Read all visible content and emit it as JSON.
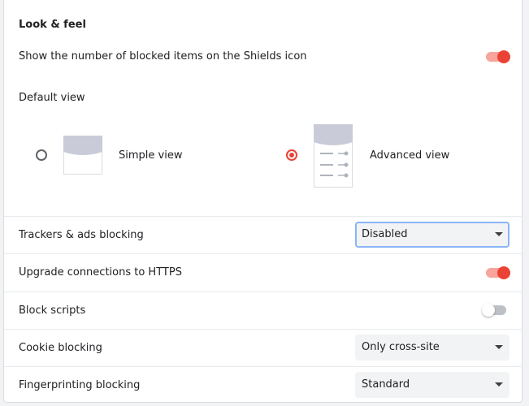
{
  "look_and_feel": {
    "title": "Look & feel",
    "shields_icon_label": "Show the number of blocked items on the Shields icon",
    "shields_icon_enabled": true,
    "default_view_label": "Default view",
    "views": [
      {
        "label": "Simple view",
        "selected": false,
        "icon": "simple-view-preview-icon"
      },
      {
        "label": "Advanced view",
        "selected": true,
        "icon": "advanced-view-preview-icon"
      }
    ]
  },
  "settings": {
    "trackers": {
      "label": "Trackers & ads blocking",
      "value": "Disabled"
    },
    "https": {
      "label": "Upgrade connections to HTTPS",
      "enabled": true
    },
    "scripts": {
      "label": "Block scripts",
      "enabled": false
    },
    "cookies": {
      "label": "Cookie blocking",
      "value": "Only cross-site"
    },
    "fingerprinting": {
      "label": "Fingerprinting blocking",
      "value": "Standard"
    }
  },
  "colors": {
    "accent": "#ea4335",
    "accent_light": "#f8a39b",
    "focus_ring": "#8ab4f8"
  }
}
